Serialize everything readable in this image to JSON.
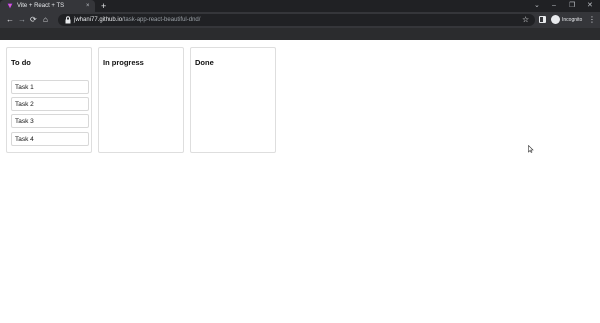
{
  "browser": {
    "tab_title": "Vite + React + TS",
    "tab_close": "×",
    "new_tab": "+",
    "url_host": "jwhani77.github.io",
    "url_path": "/task-app-react-beautiful-dnd/",
    "profile_label": "Incognito",
    "window_controls": [
      "⌄",
      "–",
      "❐",
      "✕"
    ],
    "nav": {
      "back": "←",
      "forward": "→",
      "reload": "⟳",
      "home": "⌂"
    },
    "star": "☆",
    "menu": "⋮",
    "colors": {
      "frame": "#202124",
      "toolbar": "#35363a",
      "text": "#e8eaed"
    }
  },
  "board": {
    "columns": [
      {
        "title": "To do",
        "tasks": [
          "Task 1",
          "Task 2",
          "Task 3",
          "Task 4"
        ]
      },
      {
        "title": "In progress",
        "tasks": []
      },
      {
        "title": "Done",
        "tasks": []
      }
    ]
  }
}
